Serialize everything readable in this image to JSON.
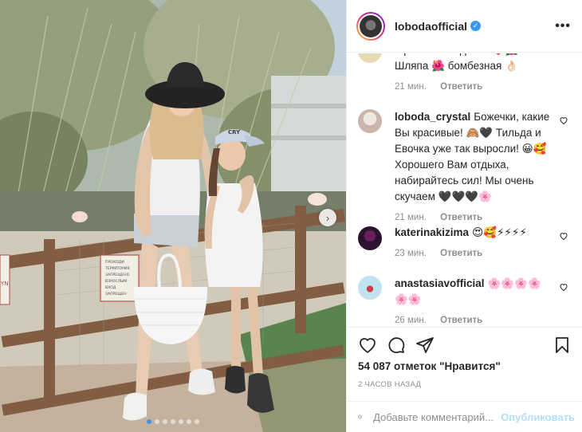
{
  "post": {
    "username": "lobodaofficial",
    "more_label": "•••",
    "verified_mark": "✓",
    "next_arrow": "›",
    "slide_count": 7,
    "active_slide": 1
  },
  "photo_text": {
    "sign_left": "YN",
    "sign_right_lines": [
      "ПРОХОДИ",
      "ТЕРРИТОРИЯ",
      "ЗАПРЕЩЕНО",
      "ВЗРОСЛЫМ",
      "ВХОД",
      "ЗАПРЕЩЕН"
    ],
    "cap_text": "CRY"
  },
  "comments": [
    {
      "user": "",
      "text": "прелестных детей ❤️🌺 Шляпа 🌺 бомбезная 👌🏻",
      "time": "21 мин.",
      "reply": "Ответить"
    },
    {
      "user": "loboda_crystal",
      "text": "Божечки, какие Вы красивые! 🙈🖤 Тильда и Евочка уже так выросли! 😀🥰 Хорошего Вам отдыха, набирайтесь сил! Мы очень скучаем 🖤🖤🖤🌸",
      "time": "21 мин.",
      "reply": "Ответить"
    },
    {
      "user": "katerinakizima",
      "text": "😍🥰⚡⚡⚡⚡",
      "time": "23 мин.",
      "reply": "Ответить"
    },
    {
      "user": "anastasiavofficial",
      "text": "🌸🌸🌸🌸🌸🌸",
      "time": "26 мин.",
      "reply": "Ответить"
    }
  ],
  "actions": {
    "likes": "54 087 отметок \"Нравится\"",
    "time_ago": "2 часов назад"
  },
  "add_comment": {
    "placeholder": "Добавьте комментарий...",
    "publish": "Опубликовать",
    "emoji_icon": "smiley-icon"
  },
  "colors": {
    "accent": "#3897f0",
    "publish_disabled": "#b2dffc",
    "meta": "#8e8e8e",
    "text": "#262626"
  }
}
